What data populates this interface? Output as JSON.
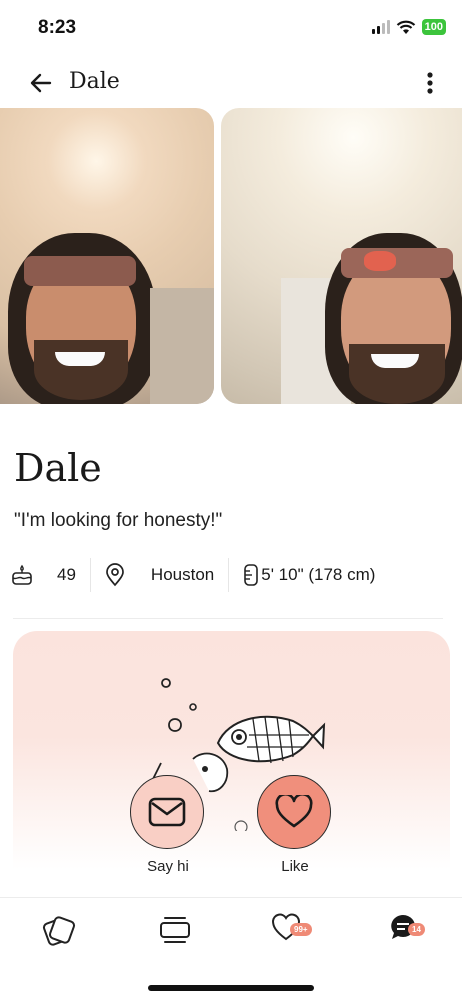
{
  "status_bar": {
    "time": "8:23",
    "battery": "100"
  },
  "header": {
    "title": "Dale"
  },
  "profile": {
    "name": "Dale",
    "quote": "\"I'm looking for honesty!\"",
    "age": "49",
    "location": "Houston",
    "height": "5' 10\" (178 cm)"
  },
  "actions": {
    "say_hi": "Say hi",
    "like": "Like"
  },
  "nav": {
    "likes_badge": "99+",
    "messages_badge": "14"
  },
  "colors": {
    "accent": "#f08f7c",
    "accent_light": "#f9cfc5",
    "card_bg": "#fbe3dd",
    "badge": "#ef8a76"
  },
  "icons": [
    "back-arrow-icon",
    "more-vertical-icon",
    "cake-icon",
    "location-pin-icon",
    "height-ruler-icon",
    "envelope-icon",
    "heart-icon",
    "discover-cards-icon",
    "standouts-icon",
    "likes-heart-icon",
    "messages-chat-icon"
  ]
}
